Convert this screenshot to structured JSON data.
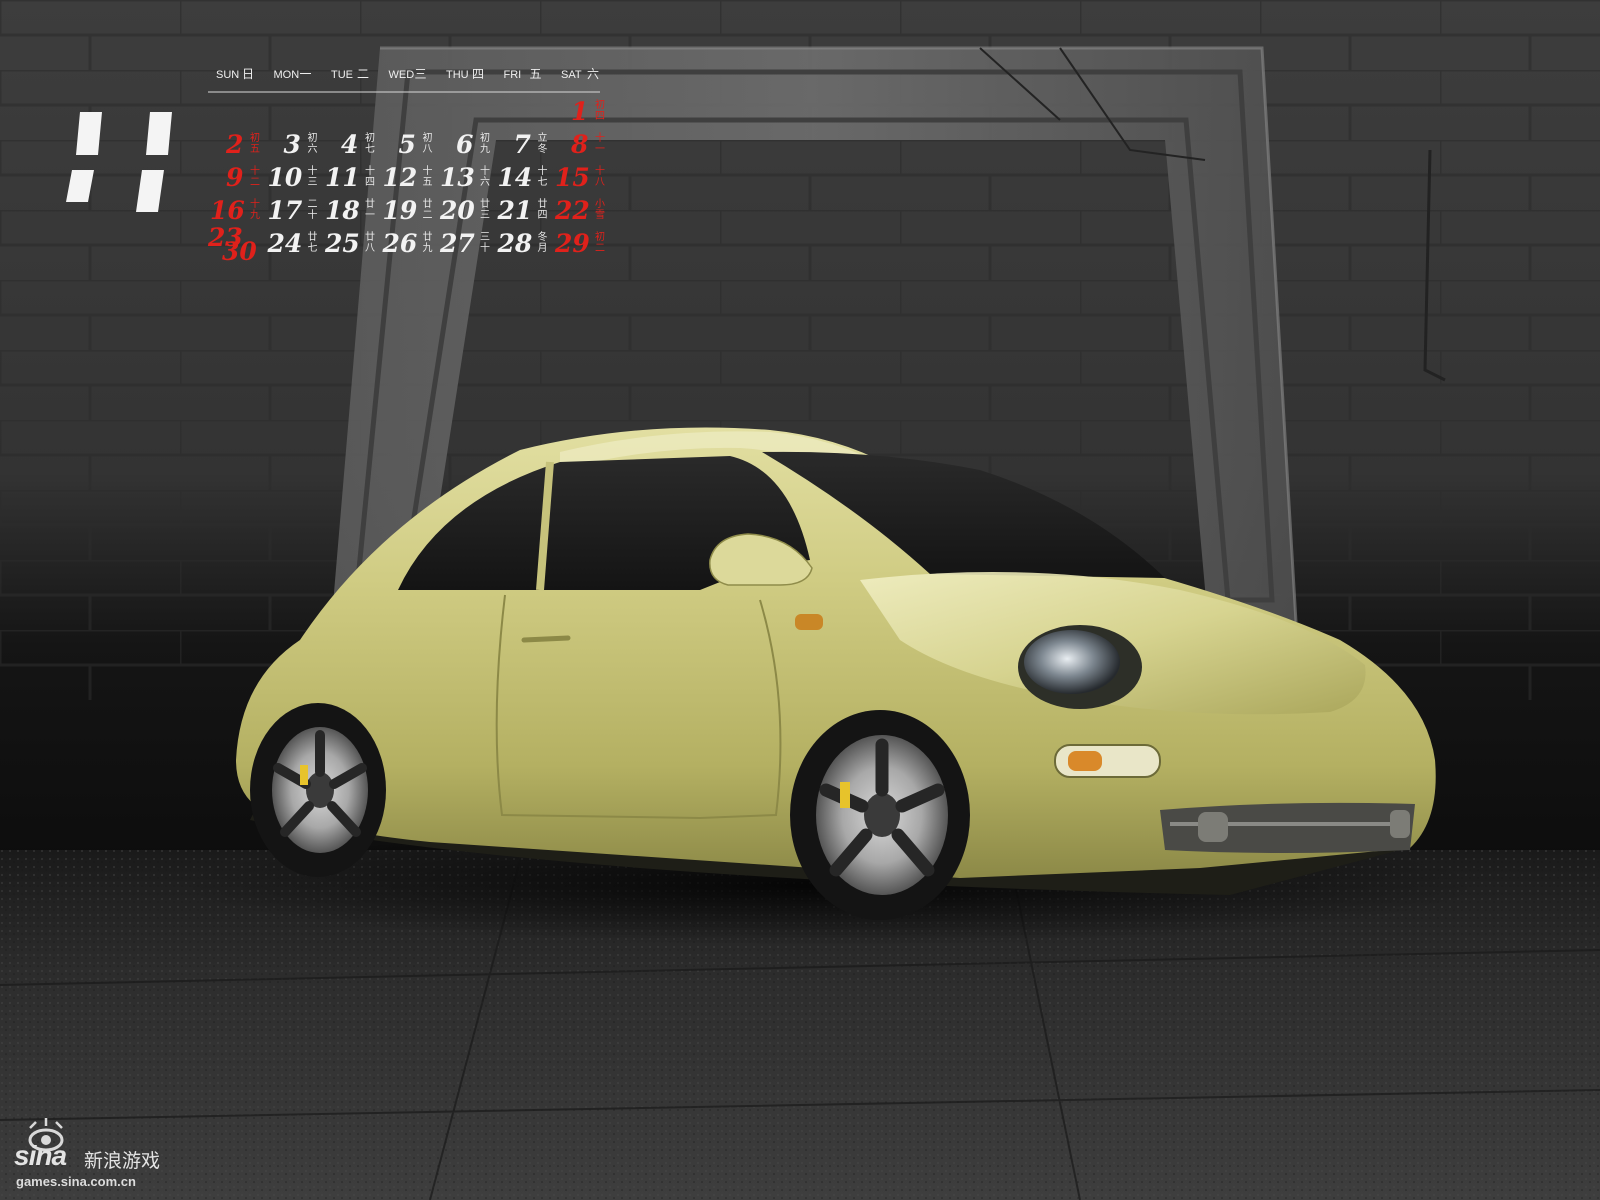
{
  "calendar": {
    "month": "11",
    "weekdays": [
      {
        "en": "SUN",
        "cn": "日",
        "weekend": true
      },
      {
        "en": "MON",
        "cn": "一",
        "weekend": false
      },
      {
        "en": "TUE",
        "cn": "二",
        "weekend": false
      },
      {
        "en": "WED",
        "cn": "三",
        "weekend": false
      },
      {
        "en": "THU",
        "cn": "四",
        "weekend": false
      },
      {
        "en": "FRI",
        "cn": "五",
        "weekend": false
      },
      {
        "en": "SAT",
        "cn": "六",
        "weekend": true
      }
    ],
    "weeks": [
      [
        null,
        null,
        null,
        null,
        null,
        null,
        {
          "d": "1",
          "l": "初四"
        }
      ],
      [
        {
          "d": "2",
          "l": "初五"
        },
        {
          "d": "3",
          "l": "初六"
        },
        {
          "d": "4",
          "l": "初七"
        },
        {
          "d": "5",
          "l": "初八"
        },
        {
          "d": "6",
          "l": "初九"
        },
        {
          "d": "7",
          "l": "立冬"
        },
        {
          "d": "8",
          "l": "十一"
        }
      ],
      [
        {
          "d": "9",
          "l": "十二"
        },
        {
          "d": "10",
          "l": "十三"
        },
        {
          "d": "11",
          "l": "十四"
        },
        {
          "d": "12",
          "l": "十五"
        },
        {
          "d": "13",
          "l": "十六"
        },
        {
          "d": "14",
          "l": "十七"
        },
        {
          "d": "15",
          "l": "十八"
        }
      ],
      [
        {
          "d": "16",
          "l": "十九"
        },
        {
          "d": "17",
          "l": "二十"
        },
        {
          "d": "18",
          "l": "廿一"
        },
        {
          "d": "19",
          "l": "廿二"
        },
        {
          "d": "20",
          "l": "廿三"
        },
        {
          "d": "21",
          "l": "廿四"
        },
        {
          "d": "22",
          "l": "小雪"
        }
      ],
      [
        {
          "d": "23/30",
          "l": ""
        },
        {
          "d": "24",
          "l": "廿七"
        },
        {
          "d": "25",
          "l": "廿八"
        },
        {
          "d": "26",
          "l": "廿九"
        },
        {
          "d": "27",
          "l": "三十"
        },
        {
          "d": "28",
          "l": "冬月"
        },
        {
          "d": "29",
          "l": "初二"
        }
      ]
    ]
  },
  "watermark": {
    "brand": "sina",
    "brand_cn": "新浪游戏",
    "url": "games.sina.com.cn"
  },
  "colors": {
    "weekend_red": "#e0211b",
    "car_body": "#c9c679",
    "wall": "#3a3a3a"
  }
}
